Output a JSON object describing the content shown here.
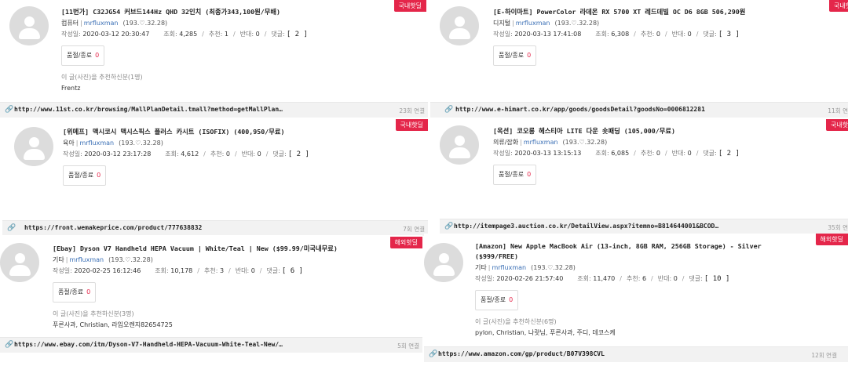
{
  "accent": "#e4264a",
  "avatar_icon": "user-silhouette-icon",
  "link_icon": "paperclip-icon",
  "labels": {
    "date": "작성일:",
    "views": "조회:",
    "likes": "추천:",
    "dislikes": "반대:",
    "comments": "댓글:",
    "sold": "품절/종료",
    "rec_suffix": "이 글(사진)을 추천하신분"
  },
  "posts": [
    {
      "badge": "국내핫딜",
      "title": "[11번가] C32JG54 커브드144Hz QHD 32인치 (최종가343,100원/무배)",
      "category": "컴퓨터",
      "author": "mrfluxman",
      "ip": "(193.♡.32.28)",
      "date": "2020-03-12 20:30:47",
      "views": "4,285",
      "likes": "1",
      "dislikes": "0",
      "comments": "[ 2 ]",
      "sold_count": "0",
      "rec_text": "이 글(사진)을 추천하신분(1명)",
      "rec_names": "Frentz",
      "url": "http://www.11st.co.kr/browsing/MallPlanDetail.tmall?method=getMallPlan…",
      "link_hits": "23회 연결"
    },
    {
      "badge": "국내핫딜",
      "title": "[E-하이마트] PowerColor 라데온 RX 5700 XT 레드데빌 OC D6 8GB 506,290원",
      "category": "디지털",
      "author": "mrfluxman",
      "ip": "(193.♡.32.28)",
      "date": "2020-03-13 17:41:08",
      "views": "6,308",
      "likes": "0",
      "dislikes": "0",
      "comments": "[ 3 ]",
      "sold_count": "0",
      "rec_text": "",
      "rec_names": "",
      "url": "http://www.e-himart.co.kr/app/goods/goodsDetail?goodsNo=0006812281",
      "link_hits": "11회 연"
    },
    {
      "badge": "국내핫딜",
      "title": "[위메프] 맥시코시 맥시스픽스 플러스 카시트 (ISOFIX) (400,950/무료)",
      "category": "육아",
      "author": "mrfluxman",
      "ip": "(193.♡.32.28)",
      "date": "2020-03-12 23:17:28",
      "views": "4,612",
      "likes": "0",
      "dislikes": "0",
      "comments": "[ 2 ]",
      "sold_count": "0",
      "rec_text": "",
      "rec_names": "",
      "url": "https://front.wemakeprice.com/product/777638832",
      "link_hits": "7회 연결"
    },
    {
      "badge": "국내핫딜",
      "title": "[옥션] 코오롱 헤스티아 LITE 다운 숏패딩 (105,000/무료)",
      "category": "의류/잡화",
      "author": "mrfluxman",
      "ip": "(193.♡.32.28)",
      "date": "2020-03-13 13:15:13",
      "views": "6,085",
      "likes": "0",
      "dislikes": "0",
      "comments": "[ 2 ]",
      "sold_count": "0",
      "rec_text": "",
      "rec_names": "",
      "url": "http://itempage3.auction.co.kr/DetailView.aspx?itemno=B814644001&BCOD…",
      "link_hits": "35회 연"
    },
    {
      "badge": "해외핫딜",
      "title": "[Ebay] Dyson V7 Handheld HEPA Vacuum | White/Teal | New ($99.99/미국내무료)",
      "category": "기타",
      "author": "mrfluxman",
      "ip": "(193.♡.32.28)",
      "date": "2020-02-25 16:12:46",
      "views": "10,178",
      "likes": "3",
      "dislikes": "0",
      "comments": "[ 6 ]",
      "sold_count": "0",
      "rec_text": "이 글(사진)을 추천하신분(3명)",
      "rec_names": "푸른사과, Christian, 라임오렌지82654725",
      "url": "https://www.ebay.com/itm/Dyson-V7-Handheld-HEPA-Vacuum-White-Teal-New/…",
      "link_hits": "5회 연결"
    },
    {
      "badge": "해외핫딜",
      "title": "[Amazon] New Apple MacBook Air (13-inch, 8GB RAM, 256GB Storage) - Silver",
      "title_cont": "($999/FREE)",
      "category": "기타",
      "author": "mrfluxman",
      "ip": "(193.♡.32.28)",
      "date": "2020-02-26 21:57:40",
      "views": "11,470",
      "likes": "6",
      "dislikes": "0",
      "comments": "[ 10 ]",
      "sold_count": "0",
      "rec_text": "이 글(사진)을 추천하신분(6명)",
      "rec_names": "pylon, Christian, 나랏님, 푸른사과, 주디, 데코스케",
      "url": "https://www.amazon.com/gp/product/B07V398CVL",
      "link_hits": "12회 연결"
    }
  ]
}
